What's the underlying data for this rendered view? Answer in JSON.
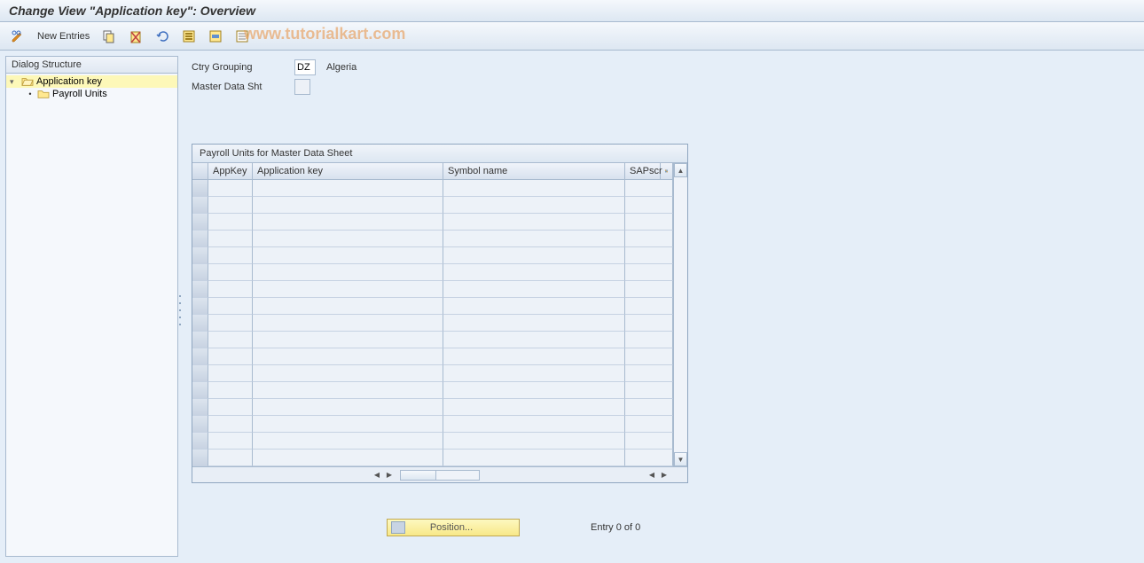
{
  "title": "Change View \"Application key\": Overview",
  "toolbar": {
    "new_entries": "New Entries"
  },
  "watermark": "www.tutorialkart.com",
  "sidebar": {
    "header": "Dialog Structure",
    "items": [
      {
        "label": "Application key",
        "selected": true
      },
      {
        "label": "Payroll Units",
        "selected": false
      }
    ]
  },
  "form": {
    "ctry_grouping_label": "Ctry Grouping",
    "ctry_grouping_value": "DZ",
    "ctry_grouping_name": "Algeria",
    "master_data_label": "Master Data Sht",
    "master_data_value": ""
  },
  "table": {
    "title": "Payroll Units for Master Data Sheet",
    "columns": {
      "appkey": "AppKey",
      "application_key": "Application key",
      "symbol_name": "Symbol name",
      "sapscript": "SAPscr"
    },
    "rows": [
      {},
      {},
      {},
      {},
      {},
      {},
      {},
      {},
      {},
      {},
      {},
      {},
      {},
      {},
      {},
      {},
      {}
    ]
  },
  "footer": {
    "position_label": "Position...",
    "entry_text": "Entry 0 of 0"
  }
}
